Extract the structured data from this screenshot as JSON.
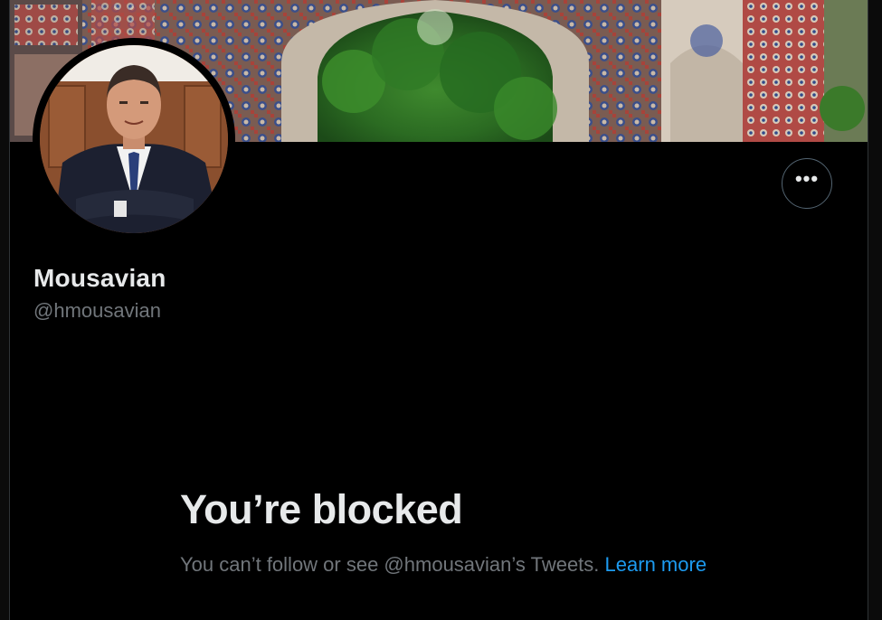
{
  "profile": {
    "display_name": "Mousavian",
    "handle": "@hmousavian",
    "more_button_icon": "more-horizontal-icon",
    "more_button_glyph": "•••"
  },
  "blocked": {
    "title": "You’re blocked",
    "message": "You can’t follow or see @hmousavian’s Tweets.",
    "link_label": "Learn more"
  },
  "colors": {
    "background": "#000000",
    "primary_text": "#e7e9ea",
    "secondary_text": "#71767b",
    "link": "#1d9bf0",
    "border": "#536471"
  }
}
